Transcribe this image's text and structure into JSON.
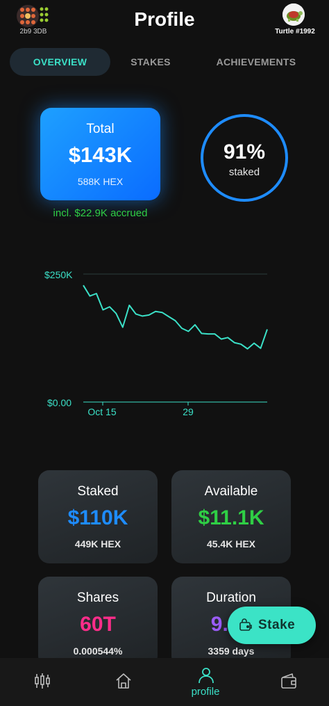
{
  "header": {
    "wallet_id": "2b9 3DB",
    "title": "Profile",
    "nft_name": "Turtle #1992"
  },
  "tabs": [
    {
      "label": "OVERVIEW",
      "active": true
    },
    {
      "label": "STAKES",
      "active": false
    },
    {
      "label": "ACHIEVEMENTS",
      "active": false
    }
  ],
  "total": {
    "label": "Total",
    "value": "$143K",
    "hex": "588K HEX",
    "accrued": "incl. $22.9K accrued"
  },
  "staked_ring": {
    "percent": "91%",
    "percent_value": 91,
    "label": "staked"
  },
  "chart_data": {
    "type": "line",
    "ytick_labels": [
      "$250K",
      "$0.00"
    ],
    "yticks": [
      250000,
      0
    ],
    "xtick_labels": [
      "Oct 15",
      "29"
    ],
    "ylim": [
      0,
      250000
    ],
    "series": [
      {
        "values": [
          228000,
          207000,
          212000,
          180000,
          186000,
          173000,
          146000,
          189000,
          172000,
          168000,
          170000,
          177000,
          175000,
          167000,
          159000,
          144000,
          138000,
          151000,
          134000,
          133000,
          133000,
          123000,
          126000,
          116000,
          113000,
          104000,
          115000,
          105000,
          142000
        ]
      }
    ],
    "line_color": "#3be0c7",
    "grid": true
  },
  "cards": {
    "staked": {
      "label": "Staked",
      "value": "$110K",
      "sub": "449K HEX",
      "color": "#1e8cff"
    },
    "available": {
      "label": "Available",
      "value": "$11.1K",
      "sub": "45.4K HEX",
      "color": "#2fcf45"
    },
    "shares": {
      "label": "Shares",
      "value": "60T",
      "sub": "0.000544%",
      "color": "#ff2d8a"
    },
    "duration": {
      "label": "Duration",
      "value": "9.20",
      "sub": "3359 days",
      "color": "#9b5cf6"
    }
  },
  "stake_button": {
    "label": "Stake",
    "icon": "wallet-lock-icon"
  },
  "bottom_nav": [
    {
      "name": "trade",
      "icon": "candlestick-icon",
      "label": ""
    },
    {
      "name": "home",
      "icon": "home-icon",
      "label": ""
    },
    {
      "name": "profile",
      "icon": "person-icon",
      "label": "profile",
      "active": true
    },
    {
      "name": "wallet",
      "icon": "wallet-icon",
      "label": ""
    }
  ],
  "colors": {
    "accent": "#3be0c7",
    "background": "#111111",
    "total_card": "#1e8cff"
  }
}
